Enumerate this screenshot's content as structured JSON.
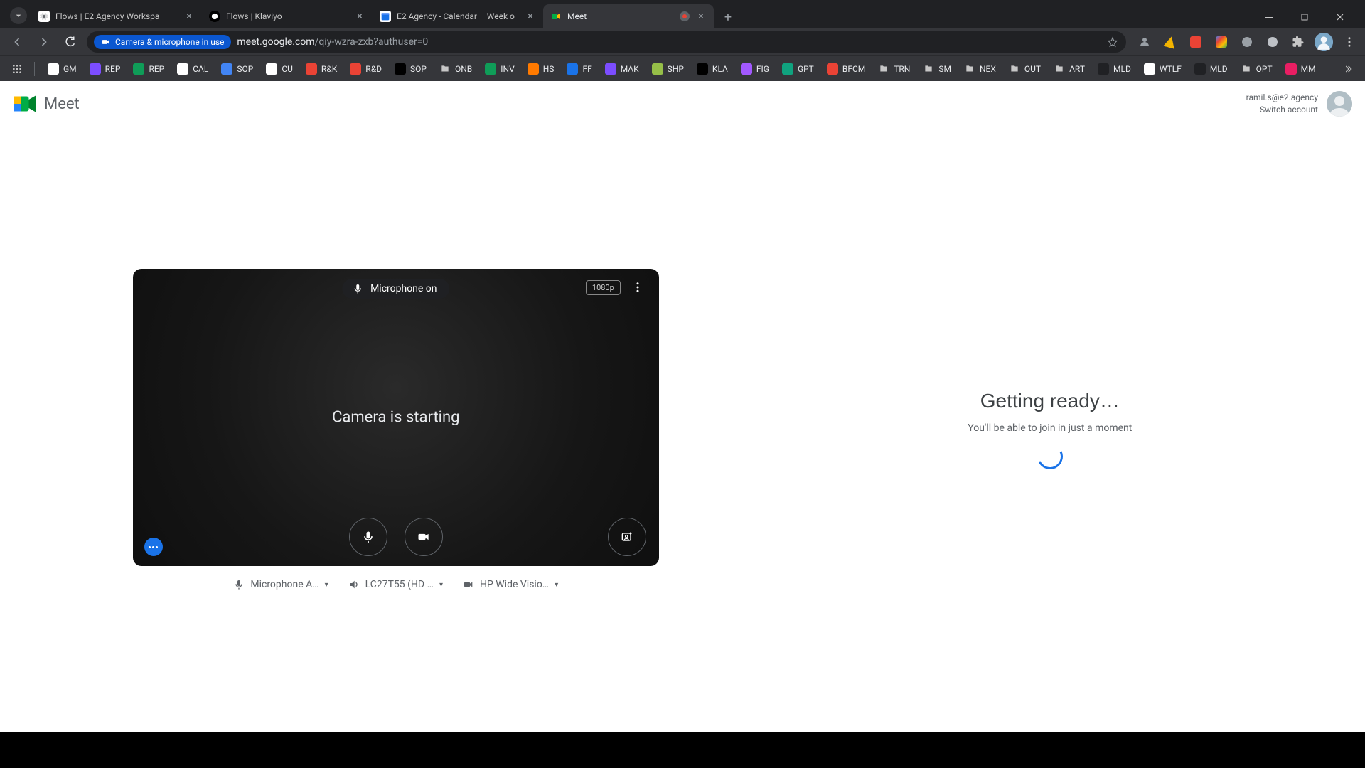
{
  "browser": {
    "tabs": [
      {
        "title": "Flows | E2 Agency Workspa",
        "favicon_bg": "#ffffff",
        "favicon_fg": "#5f6368"
      },
      {
        "title": "Flows | Klaviyo",
        "favicon_bg": "#000000",
        "favicon_fg": "#ffffff"
      },
      {
        "title": "E2 Agency - Calendar – Week o",
        "favicon_bg": "#ffffff",
        "favicon_fg": "#1a73e8"
      },
      {
        "title": "Meet",
        "favicon_bg": "#ffffff",
        "favicon_fg": "#00ac47",
        "active": true,
        "recording": true
      }
    ],
    "camera_chip": "Camera & microphone in use",
    "url_host": "meet.google.com",
    "url_path": "/qiy-wzra-zxb?authuser=0",
    "bookmarks": [
      {
        "label": "GM",
        "bg": "#ffffff"
      },
      {
        "label": "REP",
        "bg": "#7c4dff"
      },
      {
        "label": "REP",
        "bg": "#0f9d58"
      },
      {
        "label": "CAL",
        "bg": "#ffffff"
      },
      {
        "label": "SOP",
        "bg": "#4285f4"
      },
      {
        "label": "CU",
        "bg": "#ffffff"
      },
      {
        "label": "R&K",
        "bg": "#ea4335"
      },
      {
        "label": "R&D",
        "bg": "#ea4335"
      },
      {
        "label": "SOP",
        "bg": "#000000"
      },
      {
        "label": "ONB",
        "bg": "#5f6368"
      },
      {
        "label": "INV",
        "bg": "#0f9d58"
      },
      {
        "label": "HS",
        "bg": "#ff7a00"
      },
      {
        "label": "FF",
        "bg": "#1a73e8"
      },
      {
        "label": "MAK",
        "bg": "#7c4dff"
      },
      {
        "label": "SHP",
        "bg": "#96bf48"
      },
      {
        "label": "KLA",
        "bg": "#000000"
      },
      {
        "label": "FIG",
        "bg": "#a259ff"
      },
      {
        "label": "GPT",
        "bg": "#10a37f"
      },
      {
        "label": "BFCM",
        "bg": "#ea4335"
      },
      {
        "label": "TRN",
        "bg": "#5f6368"
      },
      {
        "label": "SM",
        "bg": "#5f6368"
      },
      {
        "label": "NEX",
        "bg": "#5f6368"
      },
      {
        "label": "OUT",
        "bg": "#5f6368"
      },
      {
        "label": "ART",
        "bg": "#5f6368"
      },
      {
        "label": "MLD",
        "bg": "#202124"
      },
      {
        "label": "WTLF",
        "bg": "#ffffff"
      },
      {
        "label": "MLD",
        "bg": "#202124"
      },
      {
        "label": "OPT",
        "bg": "#5f6368"
      },
      {
        "label": "MM",
        "bg": "#e91e63"
      }
    ]
  },
  "meet": {
    "product": "Meet",
    "account_email": "ramil.s@e2.agency",
    "switch_account": "Switch account",
    "mic_status": "Microphone on",
    "resolution_badge": "1080p",
    "camera_status": "Camera is starting",
    "devices": {
      "mic_label": "Microphone A…",
      "speaker_label": "LC27T55 (HD …",
      "camera_label": "HP Wide Visio…"
    },
    "ready_title": "Getting ready…",
    "ready_sub": "You'll be able to join in just a moment"
  }
}
